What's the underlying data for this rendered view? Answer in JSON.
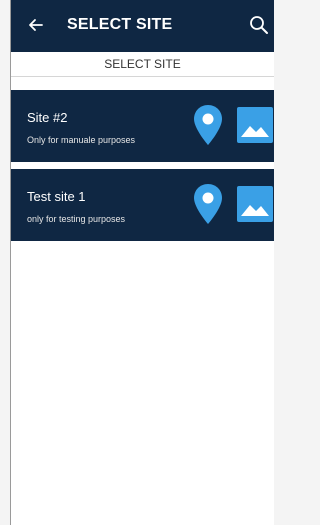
{
  "appbar": {
    "title": "SELECT SITE",
    "back_icon": "arrow-left-icon",
    "search_icon": "search-icon"
  },
  "subheader": {
    "label": "SELECT SITE"
  },
  "sites": [
    {
      "name": "Site #2",
      "description": "Only for manuale purposes",
      "pin_icon": "location-pin-icon",
      "map_icon": "image-icon"
    },
    {
      "name": "Test site 1",
      "description": "only for testing purposes",
      "pin_icon": "location-pin-icon",
      "map_icon": "image-icon"
    }
  ],
  "colors": {
    "navy": "#0f2743",
    "accent": "#3aa0e6",
    "white": "#ffffff"
  }
}
